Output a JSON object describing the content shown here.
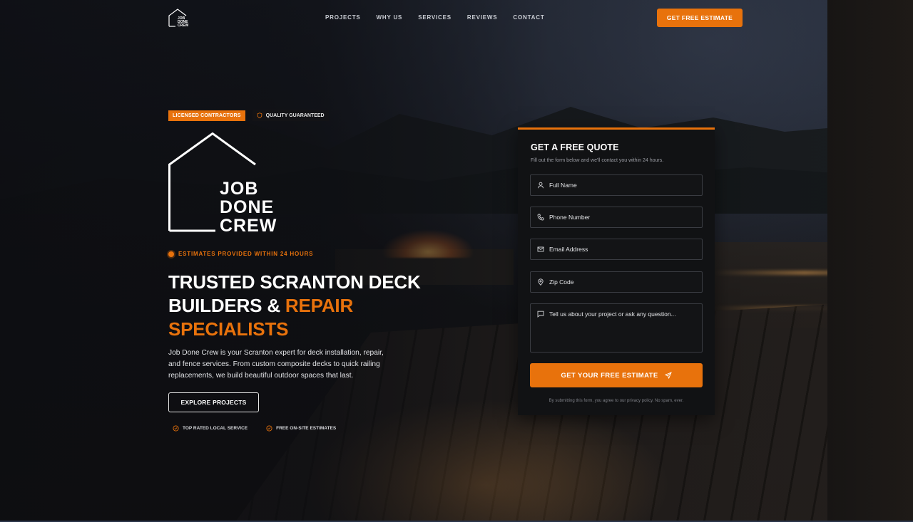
{
  "brand": {
    "logo_lines": [
      "JOB",
      "DONE",
      "CREW"
    ],
    "accent_color": "#e8720c"
  },
  "nav": {
    "links": [
      "PROJECTS",
      "WHY US",
      "SERVICES",
      "REVIEWS",
      "CONTACT"
    ],
    "cta_label": "GET FREE ESTIMATE"
  },
  "hero": {
    "badges": {
      "licensed": "LICENSED CONTRACTORS",
      "quality": "QUALITY GUARANTEED",
      "quality_icon": "shield-icon"
    },
    "estimate_note": "ESTIMATES PROVIDED WITHIN 24 HOURS",
    "headline": {
      "line1": "TRUSTED SCRANTON DECK",
      "line2_white": "BUILDERS & ",
      "line2_accent": "REPAIR",
      "line3_accent": "SPECIALISTS"
    },
    "description": "Job Done Crew is your Scranton expert for deck installation, repair, and fence services. From custom composite decks to quick railing replacements, we build beautiful outdoor spaces that last.",
    "explore_label": "EXPLORE PROJECTS",
    "features": [
      {
        "label": "TOP RATED LOCAL SERVICE",
        "icon": "check-circle-icon"
      },
      {
        "label": "FREE ON-SITE ESTIMATES",
        "icon": "check-circle-icon"
      }
    ]
  },
  "quote_form": {
    "title": "GET A FREE QUOTE",
    "subtitle": "Fill out the form below and we'll contact you within 24 hours.",
    "fields": [
      {
        "placeholder": "Full Name",
        "icon": "user-icon"
      },
      {
        "placeholder": "Phone Number",
        "icon": "phone-icon"
      },
      {
        "placeholder": "Email Address",
        "icon": "mail-icon"
      },
      {
        "placeholder": "Zip Code",
        "icon": "map-pin-icon"
      },
      {
        "placeholder": "Tell us about your project or ask any question...",
        "icon": "message-icon"
      }
    ],
    "submit_label": "GET YOUR FREE ESTIMATE",
    "submit_icon": "send-icon",
    "privacy_note": "By submitting this form, you agree to our privacy policy. No spam, ever."
  }
}
